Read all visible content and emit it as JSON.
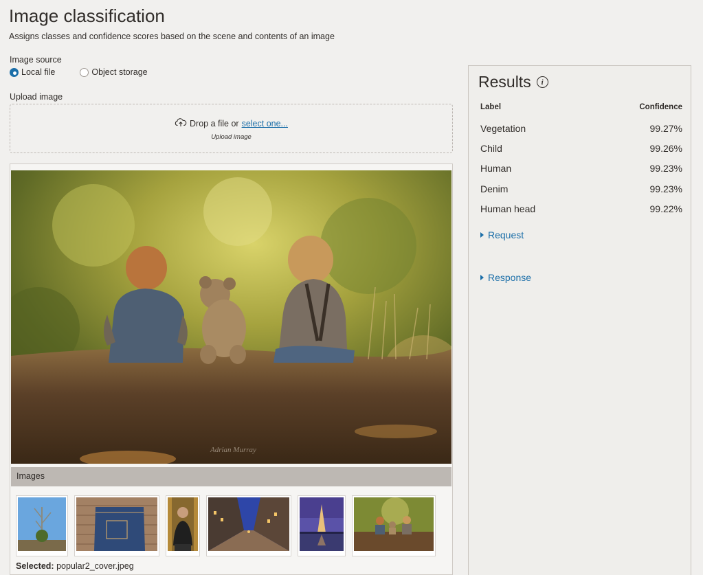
{
  "page": {
    "title": "Image classification",
    "subtitle": "Assigns classes and confidence scores based on the scene and contents of an image"
  },
  "source": {
    "label": "Image source",
    "options": [
      "Local file",
      "Object storage"
    ],
    "selected": "Local file"
  },
  "upload": {
    "label": "Upload image",
    "drop_text": "Drop a file or",
    "link_text": "select one...",
    "hint": "Upload image"
  },
  "gallery": {
    "header": "Images",
    "thumbnails": [
      "tree",
      "denim-jeans",
      "man-portrait",
      "city-street",
      "eiffel-tower",
      "kids-teddy"
    ],
    "selected_label": "Selected:",
    "selected_file": "popular2_cover.jpeg"
  },
  "preview": {
    "watermark": "Adrian Murray"
  },
  "results": {
    "title": "Results",
    "columns": [
      "Label",
      "Confidence"
    ],
    "rows": [
      {
        "label": "Vegetation",
        "confidence": "99.27%"
      },
      {
        "label": "Child",
        "confidence": "99.26%"
      },
      {
        "label": "Human",
        "confidence": "99.23%"
      },
      {
        "label": "Denim",
        "confidence": "99.23%"
      },
      {
        "label": "Human head",
        "confidence": "99.22%"
      }
    ],
    "request_label": "Request",
    "response_label": "Response"
  },
  "colors": {
    "accent": "#1b6ea8",
    "background": "#f1f0ee",
    "images_header": "#bdb8b3"
  }
}
